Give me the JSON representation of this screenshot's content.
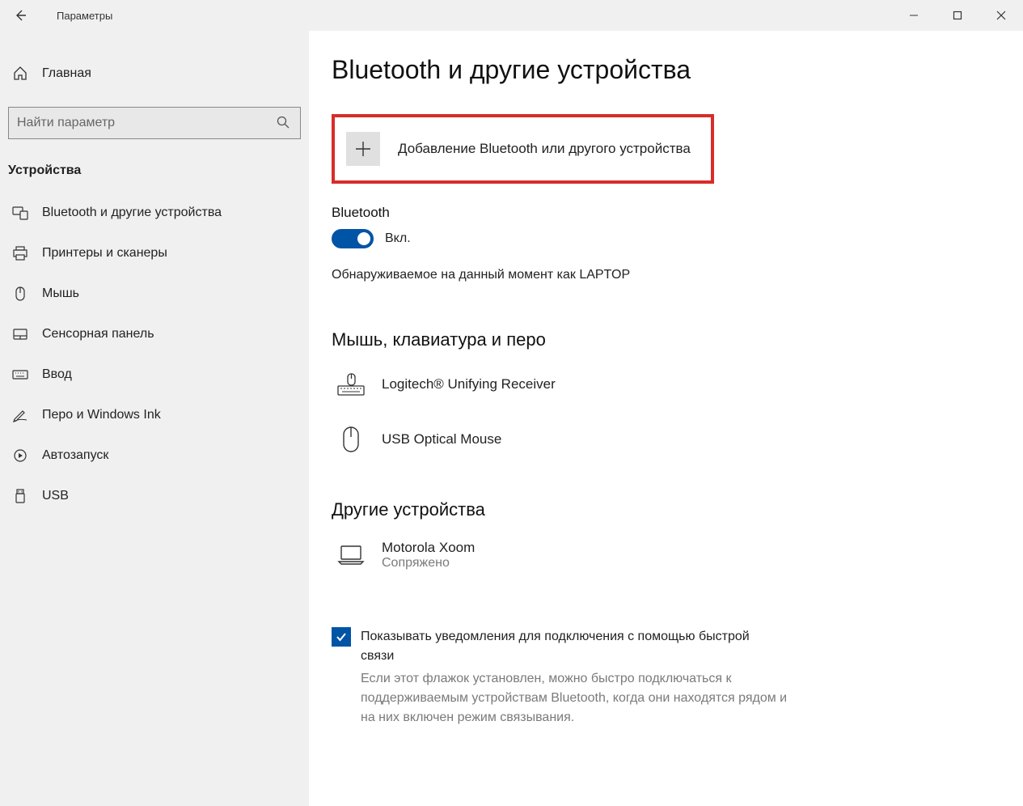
{
  "window": {
    "title": "Параметры"
  },
  "sidebar": {
    "home_label": "Главная",
    "search_placeholder": "Найти параметр",
    "section_title": "Устройства",
    "items": [
      {
        "label": "Bluetooth и другие устройства"
      },
      {
        "label": "Принтеры и сканеры"
      },
      {
        "label": "Мышь"
      },
      {
        "label": "Сенсорная панель"
      },
      {
        "label": "Ввод"
      },
      {
        "label": "Перо и Windows Ink"
      },
      {
        "label": "Автозапуск"
      },
      {
        "label": "USB"
      }
    ]
  },
  "main": {
    "title": "Bluetooth и другие устройства",
    "add_device_label": "Добавление Bluetooth или другого устройства",
    "bluetooth_heading": "Bluetooth",
    "toggle_state": "Вкл.",
    "discoverable_text": "Обнаруживаемое на данный момент как  LAPTOP",
    "section_mouse_keyboard": "Мышь, клавиатура и перо",
    "devices_mk": [
      {
        "name": "Logitech® Unifying Receiver"
      },
      {
        "name": "USB Optical Mouse"
      }
    ],
    "section_other": "Другие устройства",
    "devices_other": [
      {
        "name": "Motorola Xoom",
        "status": "Сопряжено"
      }
    ],
    "checkbox_label": "Показывать уведомления для подключения с помощью быстрой связи",
    "checkbox_desc": "Если этот флажок установлен, можно быстро подключаться к поддерживаемым устройствам Bluetooth, когда они находятся рядом и на них включен режим связывания."
  }
}
